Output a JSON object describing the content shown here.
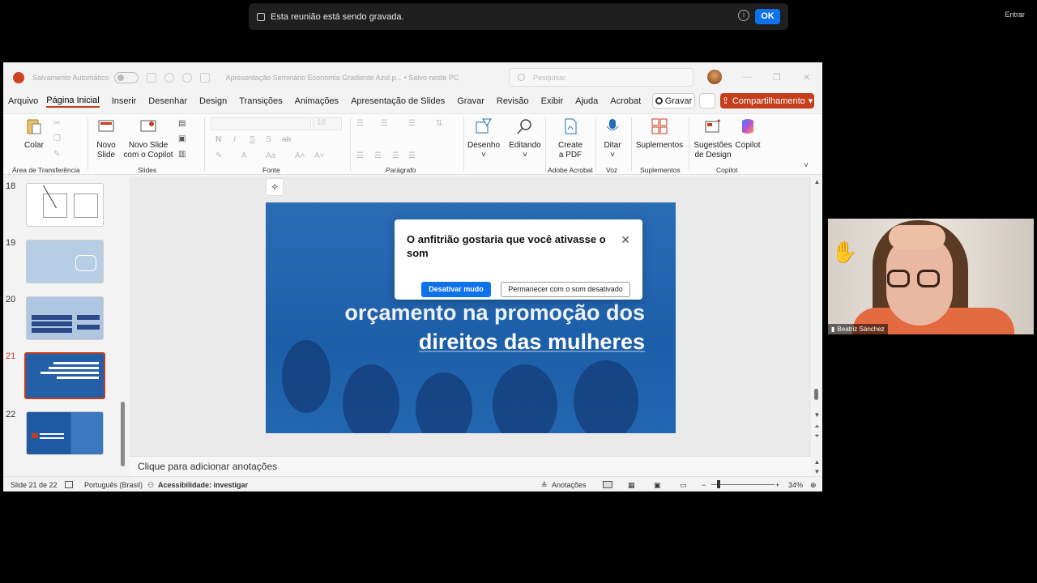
{
  "zoom": {
    "recording_banner": "Esta reunião está sendo gravada.",
    "ok_label": "OK",
    "entrar_label": "Entrar",
    "participant_name": "Beatriz Sánchez",
    "accent_color": "#0e72ed"
  },
  "powerpoint": {
    "titlebar": {
      "autosave_label": "Salvamento Automático",
      "document_title": "Apresentação Seminário Economia Gradiente Azul.p...  •  Salvo neste PC",
      "search_placeholder": "Pesquisar"
    },
    "menu_tabs": [
      "Arquivo",
      "Página Inicial",
      "Inserir",
      "Desenhar",
      "Design",
      "Transições",
      "Animações",
      "Apresentação de Slides",
      "Gravar",
      "Revisão",
      "Exibir",
      "Ajuda",
      "Acrobat"
    ],
    "active_tab": "Página Inicial",
    "gravar_button": "Gravar",
    "share_button": "Compartilhamento",
    "brand_color": "#c43e1c",
    "ribbon": {
      "colar": "Colar",
      "novo_slide_1": "Novo",
      "novo_slide_2": "Slide",
      "novo_copilot_1": "Novo Slide",
      "novo_copilot_2": "com o Copilot",
      "desenho": "Desenho",
      "editando": "Editando",
      "create_pdf_1": "Create",
      "create_pdf_2": "a PDF",
      "ditar": "Ditar",
      "suplementos": "Suplementos",
      "sugestoes_1": "Sugestões",
      "sugestoes_2": "de Design",
      "copilot": "Copilot",
      "group_labels": {
        "clipboard": "Área de Transferência",
        "slides": "Slides",
        "fonte": "Fonte",
        "paragrafo": "Parágrafo",
        "adobe": "Adobe Acrobat",
        "voz": "Voz",
        "suplementos": "Suplementos",
        "copilot": "Copilot"
      },
      "font_size": "18"
    },
    "thumbnails": [
      {
        "number": "18",
        "active": false
      },
      {
        "number": "19",
        "active": false
      },
      {
        "number": "20",
        "active": false
      },
      {
        "number": "21",
        "active": true
      },
      {
        "number": "22",
        "active": false
      }
    ],
    "slide_text_line1": "orçamento na promoção dos",
    "slide_text_line2": "direitos das mulheres",
    "notes_placeholder": "Clique para adicionar anotações",
    "status": {
      "slide_counter": "Slide 21 de 22",
      "language": "Português (Brasil)",
      "accessibility": "Acessibilidade: investigar",
      "notes_label": "Anotações",
      "zoom": "34%"
    }
  },
  "unmute_dialog": {
    "message": "O anfitrião gostaria que você ativasse o som",
    "unmute_button": "Desativar mudo",
    "keep_button": "Permanecer com o som desativado"
  }
}
